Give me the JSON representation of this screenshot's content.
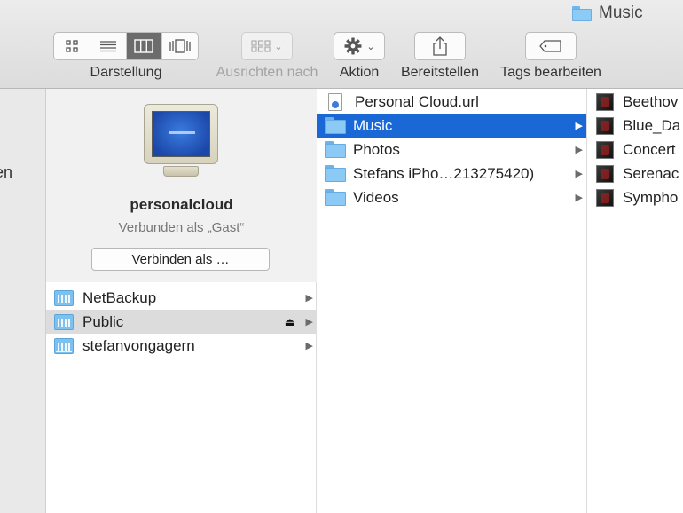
{
  "window": {
    "title": "Music"
  },
  "toolbar": {
    "view_group_label": "Darstellung",
    "view_modes": [
      "icon-view-icon",
      "list-view-icon",
      "column-view-icon",
      "coverflow-view-icon"
    ],
    "active_view": "column-view-icon",
    "arrange_label": "Ausrichten nach",
    "action_label": "Aktion",
    "share_label": "Bereitstellen",
    "tags_label": "Tags bearbeiten"
  },
  "sidebar": {
    "cut_text": "en"
  },
  "server": {
    "name": "personalcloud",
    "status": "Verbunden als „Gast“",
    "connect_label": "Verbinden als …"
  },
  "shares": [
    {
      "name": "NetBackup",
      "selected": false
    },
    {
      "name": "Public",
      "selected": true
    },
    {
      "name": "stefanvongagern",
      "selected": false
    }
  ],
  "public_items": [
    {
      "name": "Personal Cloud.url",
      "type": "file"
    },
    {
      "name": "Music",
      "type": "folder",
      "selected": true
    },
    {
      "name": "Photos",
      "type": "folder"
    },
    {
      "name": "Stefans iPho…213275420)",
      "type": "folder"
    },
    {
      "name": "Videos",
      "type": "folder"
    }
  ],
  "music_items": [
    {
      "name": "Beethov"
    },
    {
      "name": "Blue_Da"
    },
    {
      "name": "Concert"
    },
    {
      "name": "Serenac"
    },
    {
      "name": "Sympho"
    }
  ],
  "colors": {
    "selection_blue": "#1a68d6",
    "inactive_selection": "#dcdcdc",
    "folder_blue": "#8ccaf6"
  }
}
